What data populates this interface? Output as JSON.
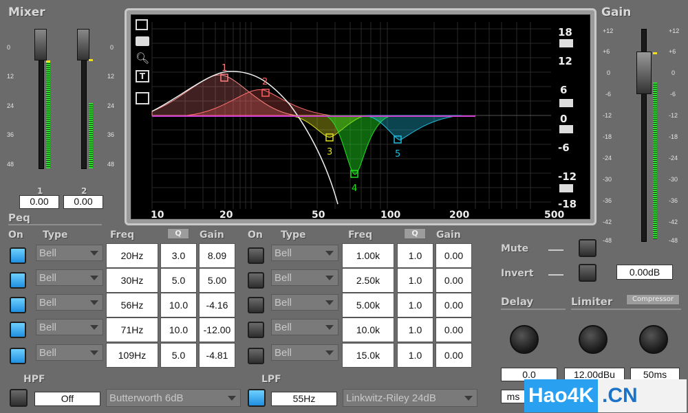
{
  "mixer": {
    "title": "Mixer",
    "scale": [
      "0",
      "12",
      "24",
      "36",
      "48"
    ],
    "channels": [
      {
        "label": "1",
        "value": "0.00"
      },
      {
        "label": "2",
        "value": "0.00"
      }
    ]
  },
  "gain_panel": {
    "title": "Gain",
    "scale_left": [
      "+12",
      "+6",
      "0",
      "-6",
      "-12",
      "-18",
      "-24",
      "-30",
      "-36",
      "-42",
      "-48"
    ],
    "scale_right": [
      "+12",
      "+6",
      "0",
      "-6",
      "-12",
      "-18",
      "-24",
      "-30",
      "-36",
      "-42",
      "-48"
    ],
    "value": "0.00dB"
  },
  "graph": {
    "x_ticks": [
      "10",
      "20",
      "50",
      "100",
      "200",
      "500"
    ],
    "y_ticks": [
      "18",
      "12",
      "6",
      "0",
      "-6",
      "-12",
      "-18"
    ],
    "points": [
      "1",
      "2",
      "3",
      "4",
      "5"
    ]
  },
  "peq": {
    "title": "Peq",
    "headers": {
      "on": "On",
      "type": "Type",
      "freq": "Freq",
      "q": "Q",
      "gain": "Gain"
    },
    "left_bands": [
      {
        "on": true,
        "type": "Bell",
        "freq": "20Hz",
        "q": "3.0",
        "gain": "8.09"
      },
      {
        "on": true,
        "type": "Bell",
        "freq": "30Hz",
        "q": "5.0",
        "gain": "5.00"
      },
      {
        "on": true,
        "type": "Bell",
        "freq": "56Hz",
        "q": "10.0",
        "gain": "-4.16"
      },
      {
        "on": true,
        "type": "Bell",
        "freq": "71Hz",
        "q": "10.0",
        "gain": "-12.00"
      },
      {
        "on": true,
        "type": "Bell",
        "freq": "109Hz",
        "q": "5.0",
        "gain": "-4.81"
      }
    ],
    "right_bands": [
      {
        "on": false,
        "type": "Bell",
        "freq": "1.00k",
        "q": "1.0",
        "gain": "0.00"
      },
      {
        "on": false,
        "type": "Bell",
        "freq": "2.50k",
        "q": "1.0",
        "gain": "0.00"
      },
      {
        "on": false,
        "type": "Bell",
        "freq": "5.00k",
        "q": "1.0",
        "gain": "0.00"
      },
      {
        "on": false,
        "type": "Bell",
        "freq": "10.0k",
        "q": "1.0",
        "gain": "0.00"
      },
      {
        "on": false,
        "type": "Bell",
        "freq": "15.0k",
        "q": "1.0",
        "gain": "0.00"
      }
    ]
  },
  "controls": {
    "mute": "Mute",
    "invert": "Invert",
    "delay": "Delay",
    "limiter": "Limiter",
    "compressor": "Compressor",
    "delay_value": "0.0",
    "delay_unit": "ms",
    "limiter_value": "12.00dBu",
    "limiter_time": "50ms"
  },
  "hpf": {
    "label": "HPF",
    "freq": "Off",
    "type": "Butterworth 6dB"
  },
  "lpf": {
    "label": "LPF",
    "freq": "55Hz",
    "type": "Linkwitz-Riley 24dB"
  },
  "watermark": {
    "left": "Hao4K",
    "right": ".CN"
  },
  "colors": {
    "accent_blue": "#2aa0f0",
    "band1": "#ff8080",
    "band3": "#e0e020",
    "band4": "#20e020",
    "band5": "#20c0e0"
  }
}
